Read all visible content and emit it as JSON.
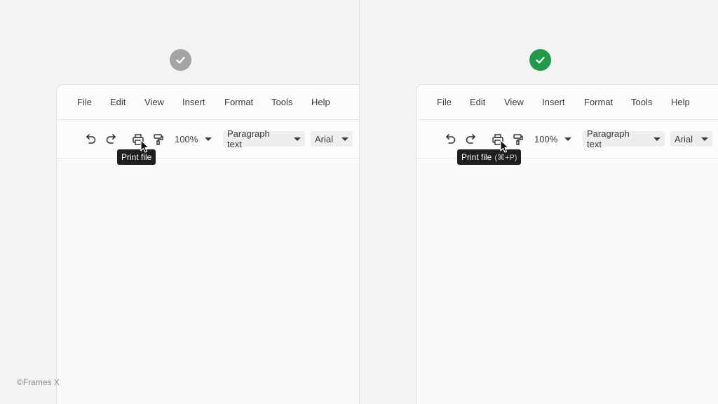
{
  "colors": {
    "neutral_badge": "#a4a4a4",
    "success_badge": "#1f9a48"
  },
  "menu": [
    "File",
    "Edit",
    "View",
    "Insert",
    "Format",
    "Tools",
    "Help"
  ],
  "toolbar": {
    "undo_icon": "undo-icon",
    "redo_icon": "redo-icon",
    "print_icon": "printer-icon",
    "format_icon": "paint-roller-icon",
    "zoom": "100%",
    "style_select": "Paragraph text",
    "font_select": "Arial"
  },
  "left": {
    "status": "neutral",
    "tooltip": "Print file"
  },
  "right": {
    "status": "success",
    "tooltip": "Print file",
    "shortcut": "(⌘+P)"
  },
  "credit": "©Frames X"
}
